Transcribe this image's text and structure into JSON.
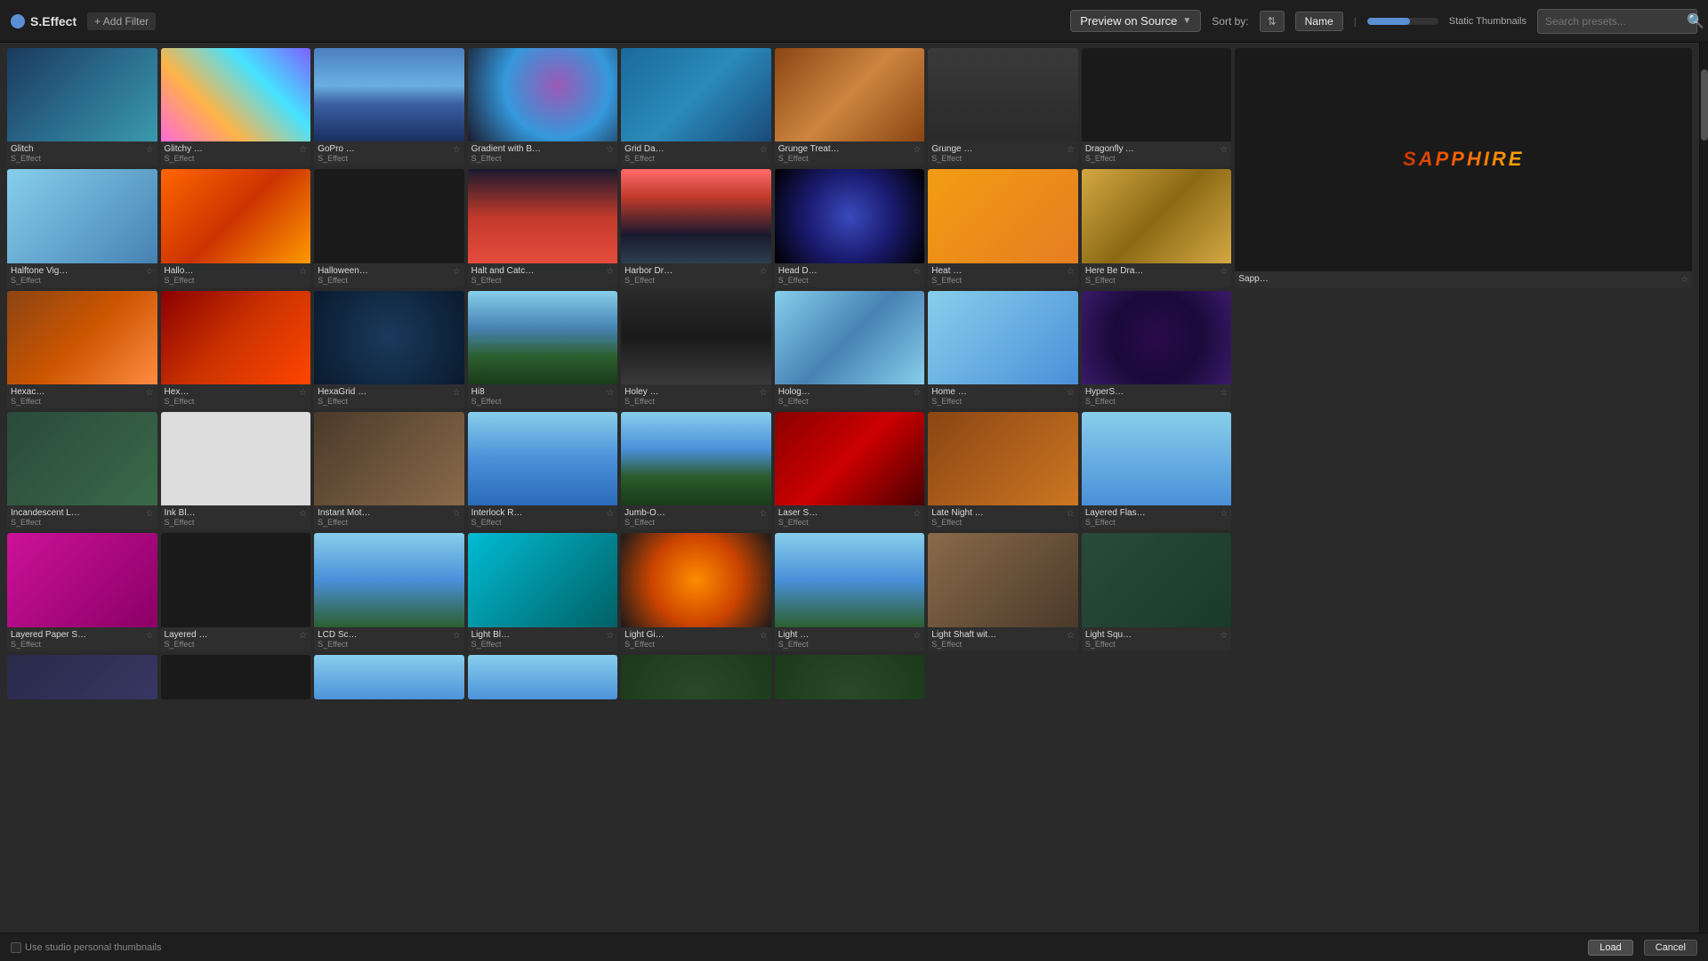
{
  "topbar": {
    "brand_label": "S.Effect",
    "add_filter_label": "+ Add Filter",
    "preview_label": "Preview on Source",
    "sort_label": "Sort by:",
    "name_label": "Name",
    "static_thumb_label": "Static Thumbnails",
    "search_placeholder": "Search presets..."
  },
  "statusbar": {
    "checkbox_label": "Use studio personal thumbnails",
    "load_label": "Load",
    "cancel_label": "Cancel"
  },
  "effects": [
    {
      "name": "Glitch",
      "type": "S_Effect",
      "thumb": "thumb-glitch"
    },
    {
      "name": "Glitchy Sort",
      "type": "S_Effect",
      "thumb": "thumb-glitchy"
    },
    {
      "name": "GoPro Fixer",
      "type": "S_Effect",
      "thumb": "thumb-gopro"
    },
    {
      "name": "Gradient with Bokeh...",
      "type": "S_Effect",
      "thumb": "thumb-gradient-bokeh"
    },
    {
      "name": "Grid Damage",
      "type": "S_Effect",
      "thumb": "thumb-grid-damage"
    },
    {
      "name": "Grunge Treatment",
      "type": "S_Effect",
      "thumb": "thumb-grunge"
    },
    {
      "name": "Grunge Wall",
      "type": "S_Effect",
      "thumb": "thumb-grunge-wall"
    },
    {
      "name": "Dragonfly Alpha",
      "type": "S_Effect",
      "thumb": "thumb-dragonfly"
    },
    {
      "name": "",
      "type": "",
      "thumb": "thumb-sapphire-main",
      "isSapphire": true
    },
    {
      "name": "",
      "type": "",
      "thumb": "thumb-empty"
    },
    {
      "name": "",
      "type": "",
      "thumb": "thumb-empty"
    },
    {
      "name": "Halftone Vignette",
      "type": "S_Effect",
      "thumb": "thumb-halftone"
    },
    {
      "name": "Halloween",
      "type": "S_Effect",
      "thumb": "thumb-halloween"
    },
    {
      "name": "Halloween Text",
      "type": "S_Effect",
      "thumb": "thumb-halloween-text"
    },
    {
      "name": "Halt and Catch Fire",
      "type": "S_Effect",
      "thumb": "thumb-halt-fire"
    },
    {
      "name": "Harbor Dreams",
      "type": "S_Effect",
      "thumb": "thumb-harbor"
    },
    {
      "name": "Head Dress",
      "type": "S_Effect",
      "thumb": "thumb-head-dress"
    },
    {
      "name": "Heat Haze",
      "type": "S_Effect",
      "thumb": "thumb-heat-haze"
    },
    {
      "name": "Here Be Dragons",
      "type": "S_Effect",
      "thumb": "thumb-here-dragons"
    },
    {
      "name": "",
      "type": "",
      "thumb": "thumb-empty"
    },
    {
      "name": "",
      "type": "",
      "thumb": "thumb-empty"
    },
    {
      "name": "",
      "type": "",
      "thumb": "thumb-empty"
    },
    {
      "name": "Hexacubes",
      "type": "S_Effect",
      "thumb": "thumb-hexacubes"
    },
    {
      "name": "Hexaflux",
      "type": "S_Effect",
      "thumb": "thumb-hexaflux"
    },
    {
      "name": "HexaGrid Echo",
      "type": "S_Effect",
      "thumb": "thumb-hexagrid"
    },
    {
      "name": "Hi8",
      "type": "S_Effect",
      "thumb": "thumb-hi8"
    },
    {
      "name": "Holey Wall",
      "type": "S_Effect",
      "thumb": "thumb-holey-wall"
    },
    {
      "name": "Hologram",
      "type": "S_Effect",
      "thumb": "thumb-hologram"
    },
    {
      "name": "Home Movie",
      "type": "S_Effect",
      "thumb": "thumb-home-movie"
    },
    {
      "name": "HyperSpace",
      "type": "S_Effect",
      "thumb": "thumb-hyperspace"
    },
    {
      "name": "",
      "type": "",
      "thumb": "thumb-empty"
    },
    {
      "name": "",
      "type": "",
      "thumb": "thumb-empty"
    },
    {
      "name": "",
      "type": "",
      "thumb": "thumb-empty"
    },
    {
      "name": "Incandescent Light...",
      "type": "S_Effect",
      "thumb": "thumb-incandescent"
    },
    {
      "name": "Ink Blotch",
      "type": "S_Effect",
      "thumb": "thumb-ink-blotch"
    },
    {
      "name": "Instant Motion...",
      "type": "S_Effect",
      "thumb": "thumb-instant-motion"
    },
    {
      "name": "Interlock Reveal",
      "type": "S_Effect",
      "thumb": "thumb-interlock"
    },
    {
      "name": "Jumb-O-tron",
      "type": "S_Effect",
      "thumb": "thumb-jumbo"
    },
    {
      "name": "Laser Show",
      "type": "S_Effect",
      "thumb": "thumb-laser"
    },
    {
      "name": "Late Night Haze",
      "type": "S_Effect",
      "thumb": "thumb-late-night"
    },
    {
      "name": "Layered Flashbulb",
      "type": "S_Effect",
      "thumb": "thumb-layered-flash"
    },
    {
      "name": "",
      "type": "",
      "thumb": "thumb-empty"
    },
    {
      "name": "",
      "type": "",
      "thumb": "thumb-empty"
    },
    {
      "name": "",
      "type": "",
      "thumb": "thumb-empty"
    },
    {
      "name": "Layered Paper Shreds",
      "type": "S_Effect",
      "thumb": "thumb-layered-paper"
    },
    {
      "name": "Layered Rain",
      "type": "S_Effect",
      "thumb": "thumb-layered-rain"
    },
    {
      "name": "LCD Screen",
      "type": "S_Effect",
      "thumb": "thumb-lcd"
    },
    {
      "name": "Light Blocks",
      "type": "S_Effect",
      "thumb": "thumb-light-blocks"
    },
    {
      "name": "Light Gizmo",
      "type": "S_Effect",
      "thumb": "thumb-light-gizmo"
    },
    {
      "name": "Light Pegs",
      "type": "S_Effect",
      "thumb": "thumb-light-pegs"
    },
    {
      "name": "Light Shaft with Dust",
      "type": "S_Effect",
      "thumb": "thumb-light-shaft"
    },
    {
      "name": "Light Squares",
      "type": "S_Effect",
      "thumb": "thumb-light-squares"
    },
    {
      "name": "",
      "type": "",
      "thumb": "thumb-empty"
    },
    {
      "name": "",
      "type": "",
      "thumb": "thumb-empty"
    },
    {
      "name": "",
      "type": "",
      "thumb": "thumb-empty"
    },
    {
      "name": "",
      "type": "",
      "thumb": "thumb-bottom1"
    },
    {
      "name": "",
      "type": "",
      "thumb": "thumb-bottom2"
    },
    {
      "name": "",
      "type": "",
      "thumb": "thumb-bottom3"
    },
    {
      "name": "",
      "type": "",
      "thumb": "thumb-bottom3"
    },
    {
      "name": "",
      "type": "",
      "thumb": "thumb-bottom4"
    },
    {
      "name": "",
      "type": "",
      "thumb": "thumb-bottom4"
    },
    {
      "name": "",
      "type": "",
      "thumb": "thumb-empty"
    },
    {
      "name": "",
      "type": "",
      "thumb": "thumb-empty"
    },
    {
      "name": "",
      "type": "",
      "thumb": "thumb-empty"
    }
  ]
}
